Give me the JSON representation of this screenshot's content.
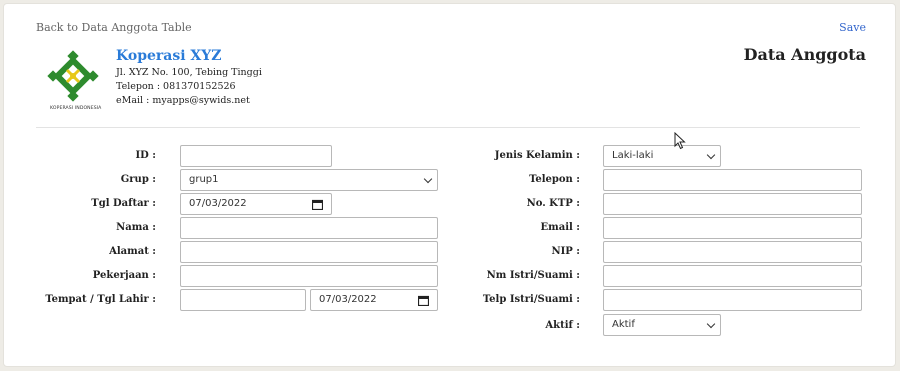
{
  "header": {
    "back_label": "Back to Data Anggota Table",
    "save_label": "Save",
    "title": "Data Anggota"
  },
  "org": {
    "name": "Koperasi XYZ",
    "address": "Jl. XYZ No. 100, Tebing Tinggi",
    "phone": "Telepon : 081370152526",
    "email": "eMail : myapps@sywids.net",
    "logo_caption": "KOPERASI INDONESIA"
  },
  "form": {
    "left": {
      "id": {
        "label": "ID :",
        "value": ""
      },
      "grup": {
        "label": "Grup :",
        "value": "grup1"
      },
      "tgl_daftar": {
        "label": "Tgl Daftar :",
        "value": "07/03/2022"
      },
      "nama": {
        "label": "Nama :",
        "value": ""
      },
      "alamat": {
        "label": "Alamat :",
        "value": ""
      },
      "pekerjaan": {
        "label": "Pekerjaan :",
        "value": ""
      },
      "tempat_tgl_lahir": {
        "label": "Tempat / Tgl Lahir :",
        "tempat_value": "",
        "tgl_value": "07/03/2022"
      }
    },
    "right": {
      "jenis_kelamin": {
        "label": "Jenis Kelamin :",
        "value": "Laki-laki"
      },
      "telepon": {
        "label": "Telepon :",
        "value": ""
      },
      "no_ktp": {
        "label": "No. KTP :",
        "value": ""
      },
      "email": {
        "label": "Email :",
        "value": ""
      },
      "nip": {
        "label": "NIP :",
        "value": ""
      },
      "nm_istri_suami": {
        "label": "Nm Istri/Suami :",
        "value": ""
      },
      "telp_istri_suami": {
        "label": "Telp Istri/Suami :",
        "value": ""
      },
      "aktif": {
        "label": "Aktif :",
        "value": "Aktif"
      }
    }
  },
  "colors": {
    "accent": "#2a7bd8",
    "logo_green": "#2e8b2e",
    "logo_yellow": "#e8c81a"
  }
}
